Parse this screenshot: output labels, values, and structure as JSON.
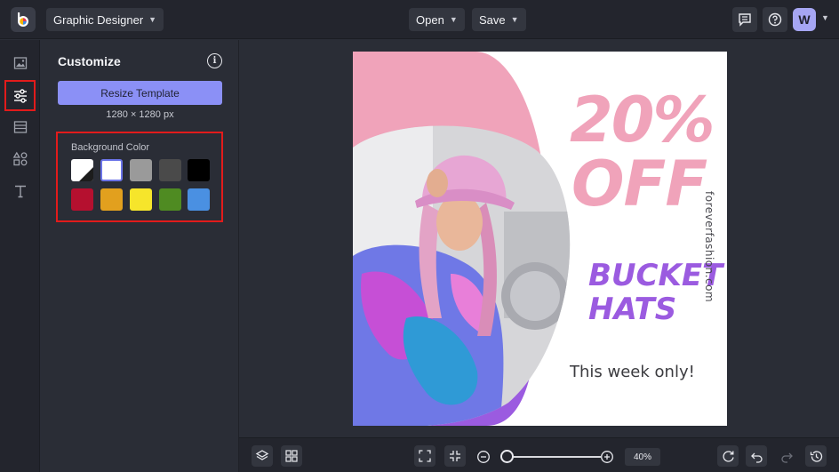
{
  "header": {
    "app_menu_label": "Graphic Designer",
    "open_label": "Open",
    "save_label": "Save",
    "avatar_initial": "W"
  },
  "rail": {
    "items": [
      {
        "name": "image-icon"
      },
      {
        "name": "sliders-icon",
        "active": true
      },
      {
        "name": "layout-icon"
      },
      {
        "name": "shapes-icon"
      },
      {
        "name": "text-icon"
      }
    ]
  },
  "panel": {
    "title": "Customize",
    "resize_button": "Resize Template",
    "dimensions": "1280 × 1280 px",
    "background_label": "Background Color",
    "swatches": [
      "#ffffff",
      "#ffffff",
      "#9a9a9a",
      "#4a4a4a",
      "#000000",
      "#b5102f",
      "#e2a01e",
      "#f6e52b",
      "#4f8b22",
      "#4a90e2"
    ]
  },
  "canvas": {
    "headline_1": "20%",
    "headline_2": "OFF",
    "subhead_1": "BUCKET",
    "subhead_2": "HATS",
    "tagline": "This week only!",
    "url": "foreverfashion.com",
    "colors": {
      "pink": "#f0a3ba",
      "purple": "#9b5be0"
    }
  },
  "footer": {
    "zoom": "40%"
  }
}
